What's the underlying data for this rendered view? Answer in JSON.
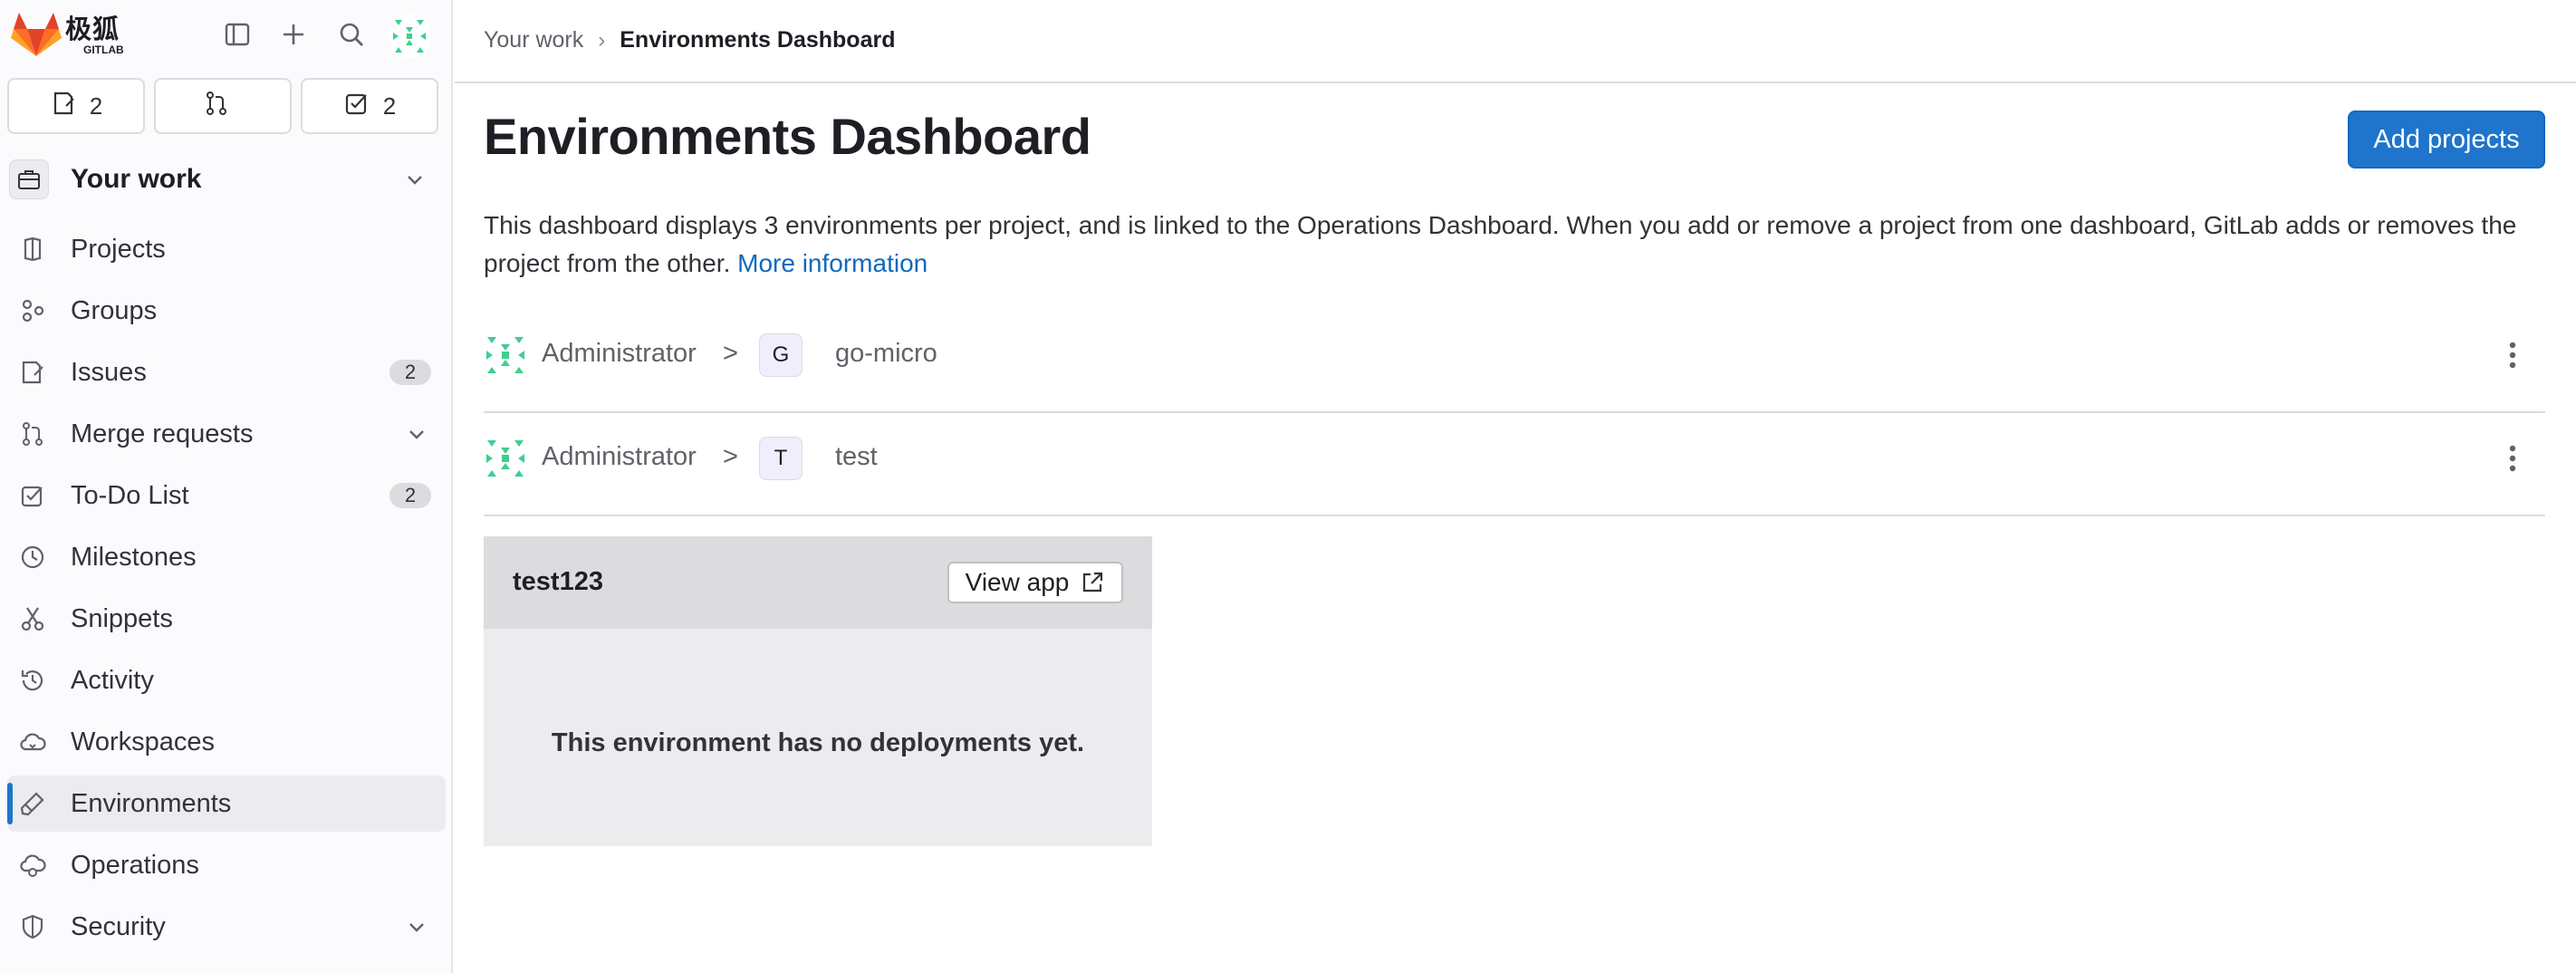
{
  "brand": {
    "name_cn": "极狐",
    "name_en": "GITLAB",
    "colors": {
      "primary": "#fc6d26",
      "accent": "#1f75cb"
    }
  },
  "topbar": {
    "icons": [
      "sidebar-toggle-icon",
      "plus-icon",
      "search-icon",
      "avatar"
    ]
  },
  "counters": [
    {
      "icon": "issues-icon",
      "count": "2"
    },
    {
      "icon": "merge-request-icon",
      "count": ""
    },
    {
      "icon": "todo-icon",
      "count": "2"
    }
  ],
  "sidebar": {
    "section_title": "Your work",
    "items": [
      {
        "label": "Projects",
        "icon": "project-icon"
      },
      {
        "label": "Groups",
        "icon": "group-icon"
      },
      {
        "label": "Issues",
        "icon": "issues-icon",
        "badge": "2"
      },
      {
        "label": "Merge requests",
        "icon": "merge-request-icon",
        "expandable": true
      },
      {
        "label": "To-Do List",
        "icon": "todo-icon",
        "badge": "2"
      },
      {
        "label": "Milestones",
        "icon": "clock-icon"
      },
      {
        "label": "Snippets",
        "icon": "scissors-icon"
      },
      {
        "label": "Activity",
        "icon": "history-icon"
      },
      {
        "label": "Workspaces",
        "icon": "cloud-icon"
      },
      {
        "label": "Environments",
        "icon": "rocket-icon",
        "active": true
      },
      {
        "label": "Operations",
        "icon": "cloud-gear-icon"
      },
      {
        "label": "Security",
        "icon": "shield-icon",
        "expandable": true
      }
    ]
  },
  "breadcrumb": {
    "parent": "Your work",
    "separator": "›",
    "current": "Environments Dashboard"
  },
  "main": {
    "title": "Environments Dashboard",
    "add_button": "Add projects",
    "description": "This dashboard displays 3 environments per project, and is linked to the Operations Dashboard. When you add or remove a project from one dashboard, GitLab adds or removes the project from the other.",
    "more_info": "More information",
    "projects": [
      {
        "owner": "Administrator",
        "separator": ">",
        "letter": "G",
        "name": "go-micro"
      },
      {
        "owner": "Administrator",
        "separator": ">",
        "letter": "T",
        "name": "test"
      }
    ],
    "environment": {
      "name": "test123",
      "view_app": "View app",
      "empty_text": "This environment has no deployments yet."
    }
  }
}
